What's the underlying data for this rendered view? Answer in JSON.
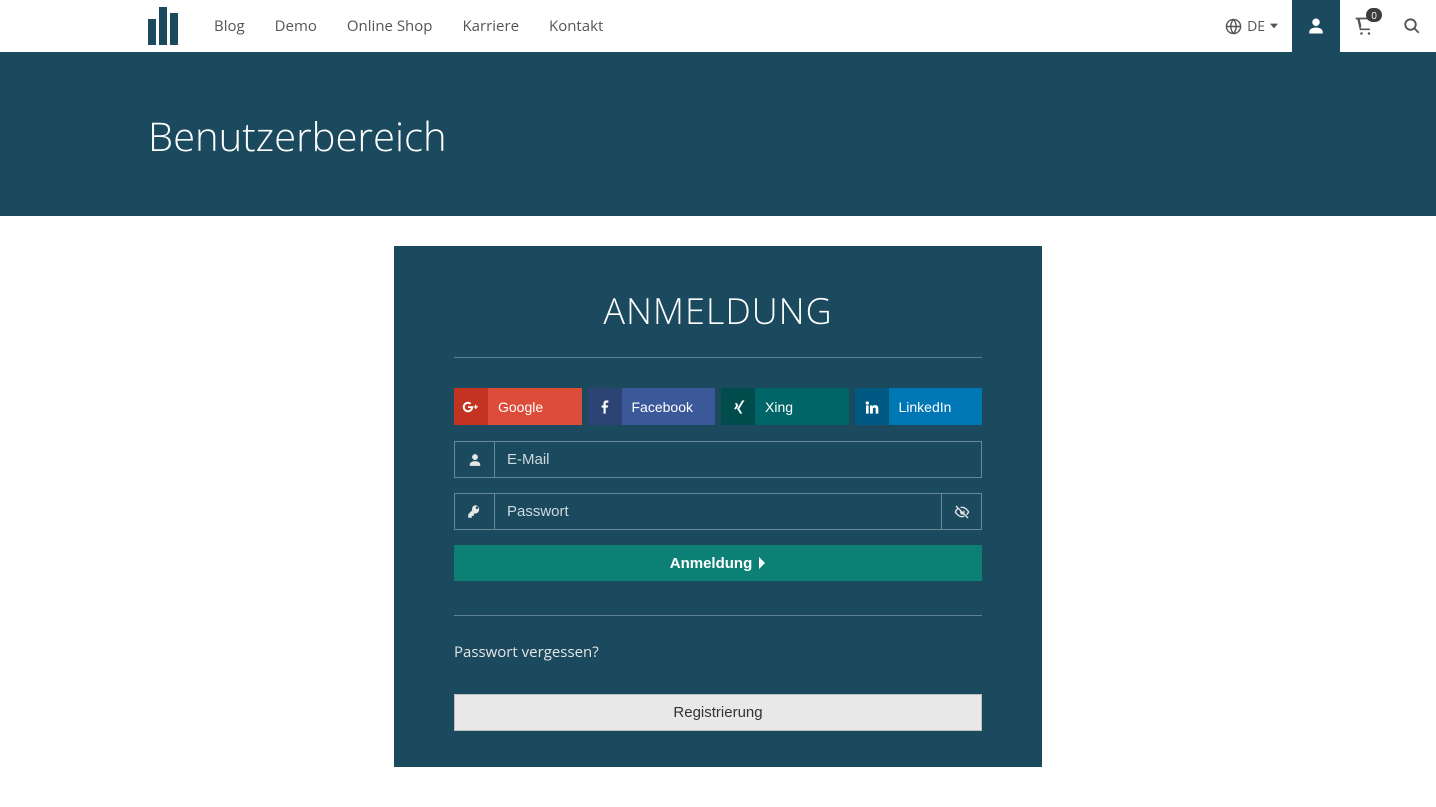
{
  "nav": {
    "items": [
      "Blog",
      "Demo",
      "Online Shop",
      "Karriere",
      "Kontakt"
    ],
    "lang": "DE",
    "cart_count": "0"
  },
  "hero": {
    "title": "Benutzerbereich"
  },
  "card": {
    "title": "ANMELDUNG",
    "social": {
      "google": "Google",
      "facebook": "Facebook",
      "xing": "Xing",
      "linkedin": "LinkedIn"
    },
    "email_placeholder": "E-Mail",
    "password_placeholder": "Passwort",
    "submit": "Anmeldung",
    "forgot": "Passwort vergessen?",
    "register": "Registrierung"
  }
}
